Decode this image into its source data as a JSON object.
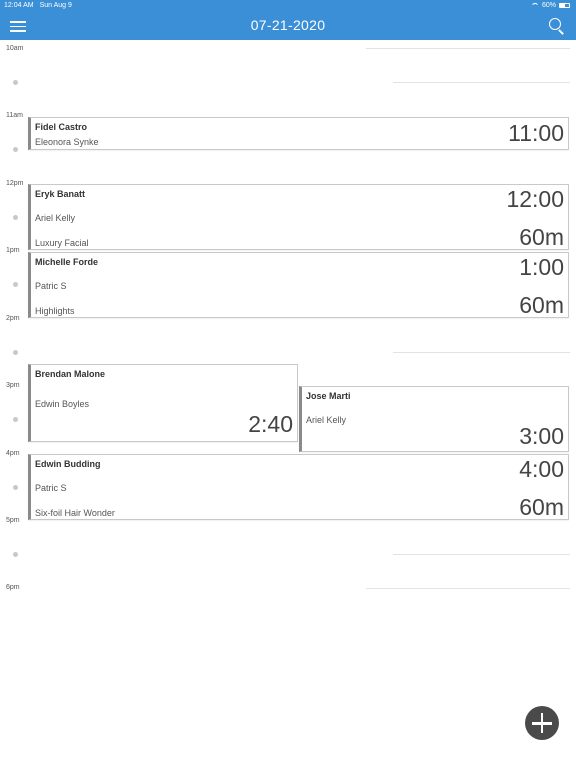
{
  "status_bar": {
    "time": "12:04 AM",
    "date": "Sun Aug 9",
    "battery_text": "60%"
  },
  "nav": {
    "title": "07-21-2020",
    "menu_icon": "hamburger-menu-icon",
    "search_icon": "search-icon",
    "accent_color": "#3a8fd6"
  },
  "hours": [
    "10am",
    "11am",
    "12pm",
    "1pm",
    "2pm",
    "3pm",
    "4pm",
    "5pm",
    "6pm"
  ],
  "appointments": [
    {
      "client": "Fidel Castro",
      "staff": "Eleonora Synke",
      "service": "",
      "time": "11:00",
      "duration": ""
    },
    {
      "client": "Eryk Banatt",
      "staff": "Ariel Kelly",
      "service": "Luxury Facial",
      "time": "12:00",
      "duration": "60m"
    },
    {
      "client": "Michelle Forde",
      "staff": "Patric S",
      "service": "Highlights",
      "time": "1:00",
      "duration": "60m"
    },
    {
      "client": "Brendan Malone",
      "staff": "Edwin Boyles",
      "service": "",
      "time": "2:40",
      "duration": ""
    },
    {
      "client": "Jose Marti",
      "staff": "Ariel Kelly",
      "service": "",
      "time": "3:00",
      "duration": ""
    },
    {
      "client": "Edwin Budding",
      "staff": "Patric S",
      "service": "Six-foil Hair Wonder",
      "time": "4:00",
      "duration": "60m"
    }
  ],
  "fab": {
    "icon": "plus-icon"
  }
}
